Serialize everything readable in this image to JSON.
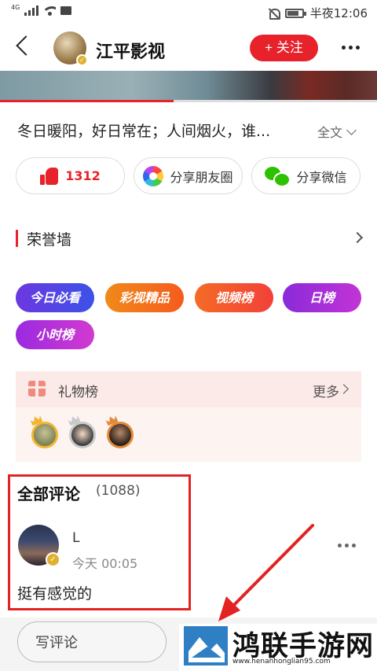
{
  "statusbar": {
    "network": "4G",
    "time": "半夜12:06"
  },
  "header": {
    "title": "江平影视",
    "follow_label": "+ 关注"
  },
  "video": {
    "progress": 0.46
  },
  "description": {
    "text": "冬日暖阳，好日常在；人间烟火，谁...",
    "expand_label": "全文"
  },
  "actions": {
    "like_count": "1312",
    "share_moments": "分享朋友圈",
    "share_wechat": "分享微信"
  },
  "honor": {
    "title": "荣誉墙",
    "badges": [
      "今日必看",
      "彩视精品",
      "视频榜",
      "日榜",
      "小时榜"
    ]
  },
  "gift": {
    "title": "礼物榜",
    "more_label": "更多"
  },
  "comments": {
    "title": "全部评论",
    "count": "(1088)",
    "items": [
      {
        "name": "L",
        "time": "今天 00:05",
        "text": "挺有感觉的"
      }
    ]
  },
  "bottom": {
    "write_placeholder": "写评论"
  },
  "watermark": {
    "text": "鸿联手游网",
    "url": "www.henanhonglian95.com"
  },
  "colors": {
    "accent": "#e8222b",
    "highlight_box": "#e32222"
  }
}
